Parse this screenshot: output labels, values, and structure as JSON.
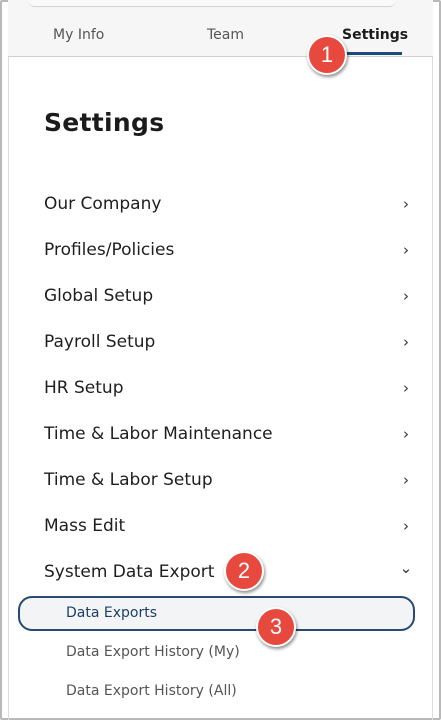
{
  "tabs": {
    "my_info": "My Info",
    "team": "Team",
    "settings": "Settings"
  },
  "page_title": "Settings",
  "menu": [
    {
      "label": "Our Company",
      "chevron": "›"
    },
    {
      "label": "Profiles/Policies",
      "chevron": "›"
    },
    {
      "label": "Global Setup",
      "chevron": "›"
    },
    {
      "label": "Payroll Setup",
      "chevron": "›"
    },
    {
      "label": "HR Setup",
      "chevron": "›"
    },
    {
      "label": "Time & Labor Maintenance",
      "chevron": "›"
    },
    {
      "label": "Time & Labor Setup",
      "chevron": "›"
    },
    {
      "label": "Mass Edit",
      "chevron": "›"
    },
    {
      "label": "System Data Export",
      "chevron": "⌄"
    }
  ],
  "submenu": [
    {
      "label": "Data Exports"
    },
    {
      "label": "Data Export History (My)"
    },
    {
      "label": "Data Export History (All)"
    }
  ],
  "badges": [
    "1",
    "2",
    "3"
  ],
  "colors": {
    "accent": "#1d4a78",
    "badge": "#e8493f"
  }
}
